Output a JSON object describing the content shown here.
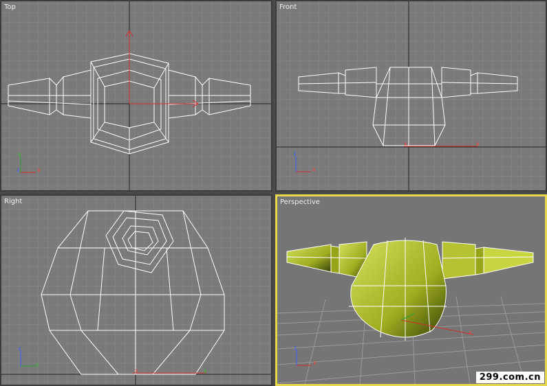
{
  "viewports": {
    "top": {
      "label": "Top"
    },
    "front": {
      "label": "Front"
    },
    "right": {
      "label": "Right"
    },
    "perspective": {
      "label": "Perspective",
      "active": true
    }
  },
  "axes": {
    "x": "x",
    "y": "y",
    "z": "z"
  },
  "colors": {
    "viewport_bg": "#7a7a7a",
    "grid": "#8a8a8a",
    "wire": "#ffffff",
    "active_border": "#e6d84a",
    "mesh_fill": "#b8c830"
  },
  "watermark": "299.com.cn"
}
